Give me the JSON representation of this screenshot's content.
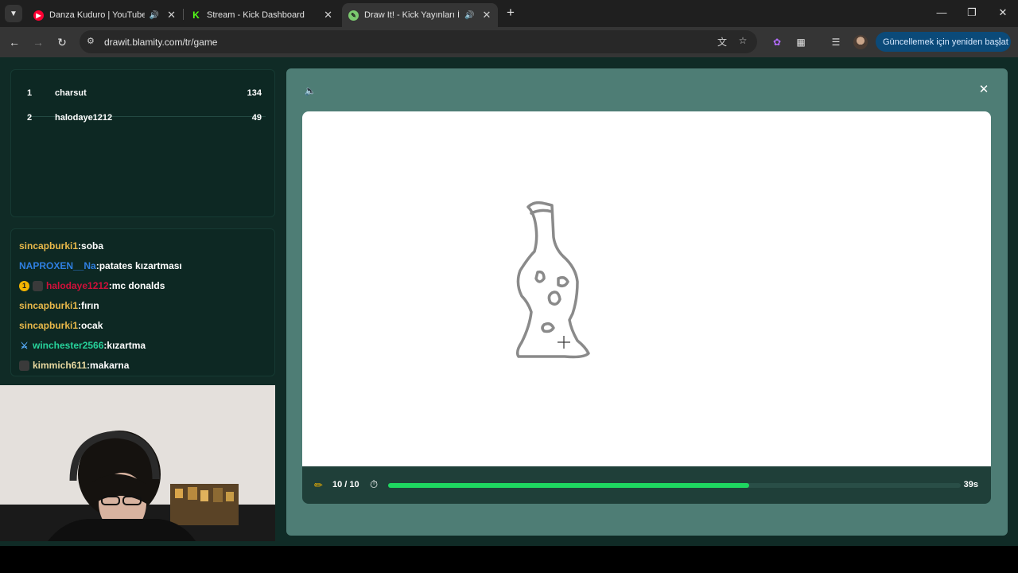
{
  "browser": {
    "tabs": [
      {
        "title": "Danza Kuduro | YouTube M",
        "favicon": "youtube-music-icon",
        "color": "#ff0033",
        "audio": true
      },
      {
        "title": "Stream - Kick Dashboard",
        "favicon": "kick-icon",
        "color": "#53fc18",
        "audio": false
      },
      {
        "title": "Draw It! - Kick Yayınları İçin",
        "favicon": "drawit-icon",
        "color": "#7bc96f",
        "audio": true,
        "active": true
      }
    ],
    "url": "drawit.blamity.com/tr/game",
    "update_button": "Güncellemek için yeniden başlat"
  },
  "leaderboard": {
    "entries": [
      {
        "rank": "1",
        "name": "charsut",
        "score": "134"
      },
      {
        "rank": "2",
        "name": "halodaye1212",
        "score": "49"
      }
    ]
  },
  "chat": {
    "messages": [
      {
        "user": "sincapburki1",
        "text": "soba",
        "color": "#e8b84a"
      },
      {
        "user": "NAPROXEN__Na",
        "text": "patates kızartması",
        "color": "#2f7fe0"
      },
      {
        "user": "halodaye1212",
        "text": "mc donalds",
        "color": "#d0103a",
        "badges": [
          "gift-badge-icon",
          "subscriber-badge-icon"
        ]
      },
      {
        "user": "sincapburki1",
        "text": "fırın",
        "color": "#e8b84a"
      },
      {
        "user": "sincapburki1",
        "text": "ocak",
        "color": "#e8b84a"
      },
      {
        "user": "winchester2566",
        "text": "kızartma",
        "color": "#27d39b",
        "badges": [
          "sword-badge-icon"
        ]
      },
      {
        "user": "kimmich611",
        "text": "makarna",
        "color": "#e8d9a0",
        "badges": [
          "subscriber-badge-icon"
        ]
      }
    ]
  },
  "game": {
    "round": "10 / 10",
    "time_left": "39s",
    "timer_progress": 0.63,
    "accent": "#1ed760"
  }
}
